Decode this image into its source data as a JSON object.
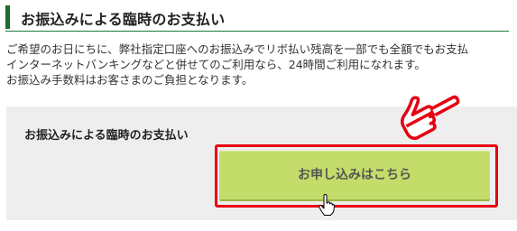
{
  "section": {
    "title": "お振込みによる臨時のお支払い"
  },
  "intro": {
    "lines": [
      "ご希望のお日にちに、弊社指定口座へのお振込みでリボ払い残高を一部でも全額でもお支払",
      "インターネットバンキングなどと併せてのご利用なら、24時間ご利用になれます。",
      "お振込み手数料はお客さまのご負担となります。"
    ]
  },
  "panel": {
    "label": "お振込みによる臨時のお支払い",
    "button_label": "お申し込みはこちら"
  },
  "colors": {
    "heading_accent": "#1e6b2e",
    "button_fill": "#c4dc6a",
    "highlight_red": "#e60012",
    "panel_bg": "#eeeeee"
  },
  "icons": {
    "pointer": "pointing-hand-icon",
    "cursor": "hand-cursor-icon"
  }
}
